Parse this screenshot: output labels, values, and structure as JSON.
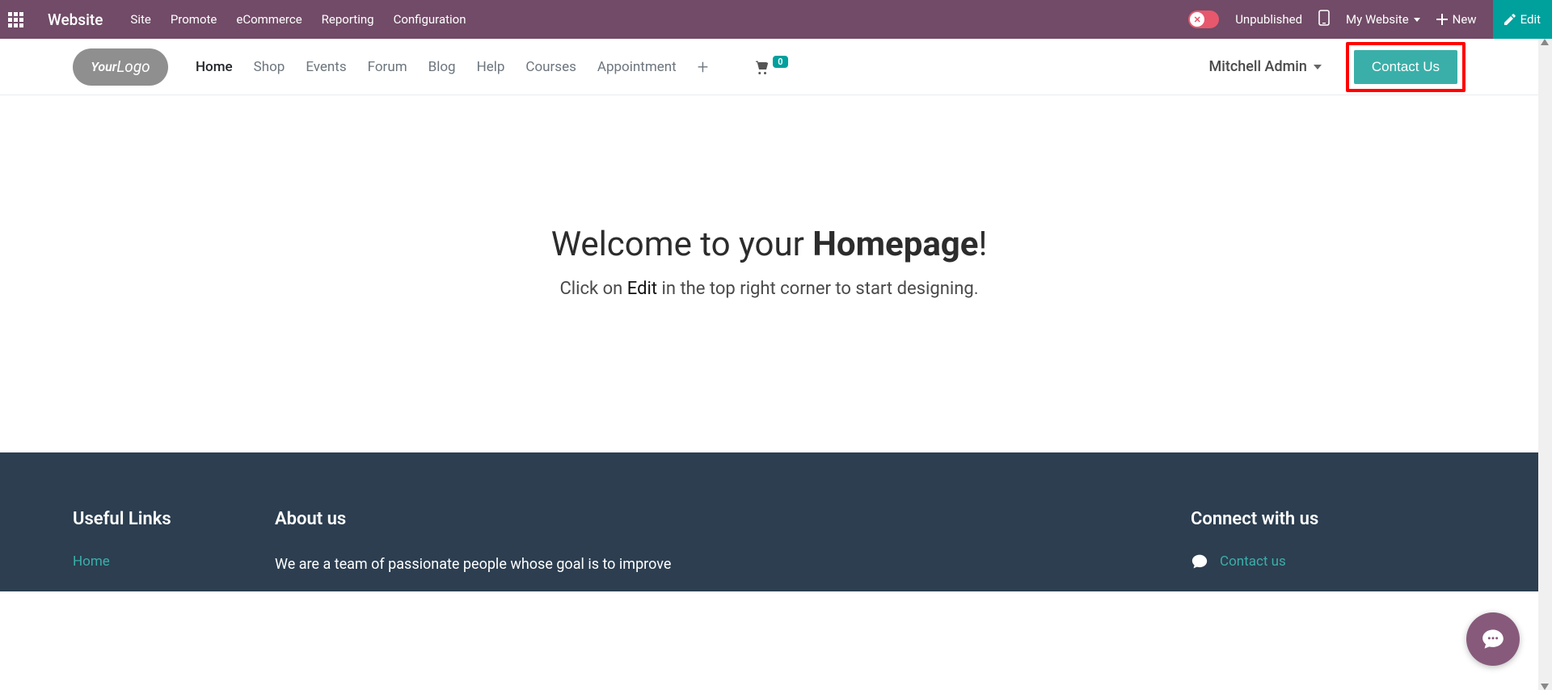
{
  "topbar": {
    "brand": "Website",
    "menu": [
      "Site",
      "Promote",
      "eCommerce",
      "Reporting",
      "Configuration"
    ],
    "publish_state": "Unpublished",
    "website_selector": "My Website",
    "new_label": "New",
    "edit_label": "Edit"
  },
  "site_header": {
    "logo_your": "Your",
    "logo_logo": "Logo",
    "nav": [
      "Home",
      "Shop",
      "Events",
      "Forum",
      "Blog",
      "Help",
      "Courses",
      "Appointment"
    ],
    "active_index": 0,
    "cart_count": "0",
    "user_name": "Mitchell Admin",
    "contact_btn": "Contact Us"
  },
  "hero": {
    "title_pre": "Welcome to your ",
    "title_strong": "Homepage",
    "title_post": "!",
    "sub_pre": "Click on ",
    "sub_edit": "Edit",
    "sub_post": " in the top right corner to start designing."
  },
  "footer": {
    "useful_title": "Useful Links",
    "useful_links": [
      "Home"
    ],
    "about_title": "About us",
    "about_text": "We are a team of passionate people whose goal is to improve",
    "connect_title": "Connect with us",
    "connect_link": "Contact us"
  }
}
